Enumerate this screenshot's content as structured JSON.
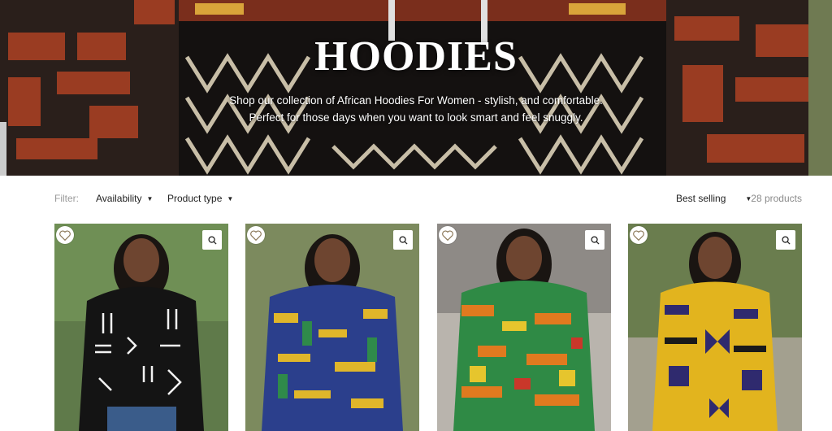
{
  "hero": {
    "title": "HOODIES",
    "subtitle_line1": "Shop our collection of African Hoodies For Women - stylish, and comfortable.",
    "subtitle_line2": "Perfect for those days when you want to look smart and feel snuggly."
  },
  "filters": {
    "label": "Filter:",
    "availability": "Availability",
    "product_type": "Product type",
    "sort": "Best selling",
    "count": "28 products"
  },
  "products": [
    {
      "image": "woman wearing black mudcloth print hoodie",
      "wishlist_icon": "heart-icon",
      "quickview_icon": "search-icon"
    },
    {
      "image": "woman wearing blue and yellow kente hoodie",
      "wishlist_icon": "heart-icon",
      "quickview_icon": "search-icon"
    },
    {
      "image": "woman wearing orange and green kente hoodie",
      "wishlist_icon": "heart-icon",
      "quickview_icon": "search-icon"
    },
    {
      "image": "woman wearing yellow and purple kente hoodie",
      "wishlist_icon": "heart-icon",
      "quickview_icon": "search-icon"
    }
  ],
  "colors": {
    "hero_bg": "#1c1715",
    "hero_rust": "#9a3c22",
    "hero_cream": "#e8ddc2",
    "muted_text": "#9a9a9a",
    "count_text": "#8a8a8a"
  }
}
